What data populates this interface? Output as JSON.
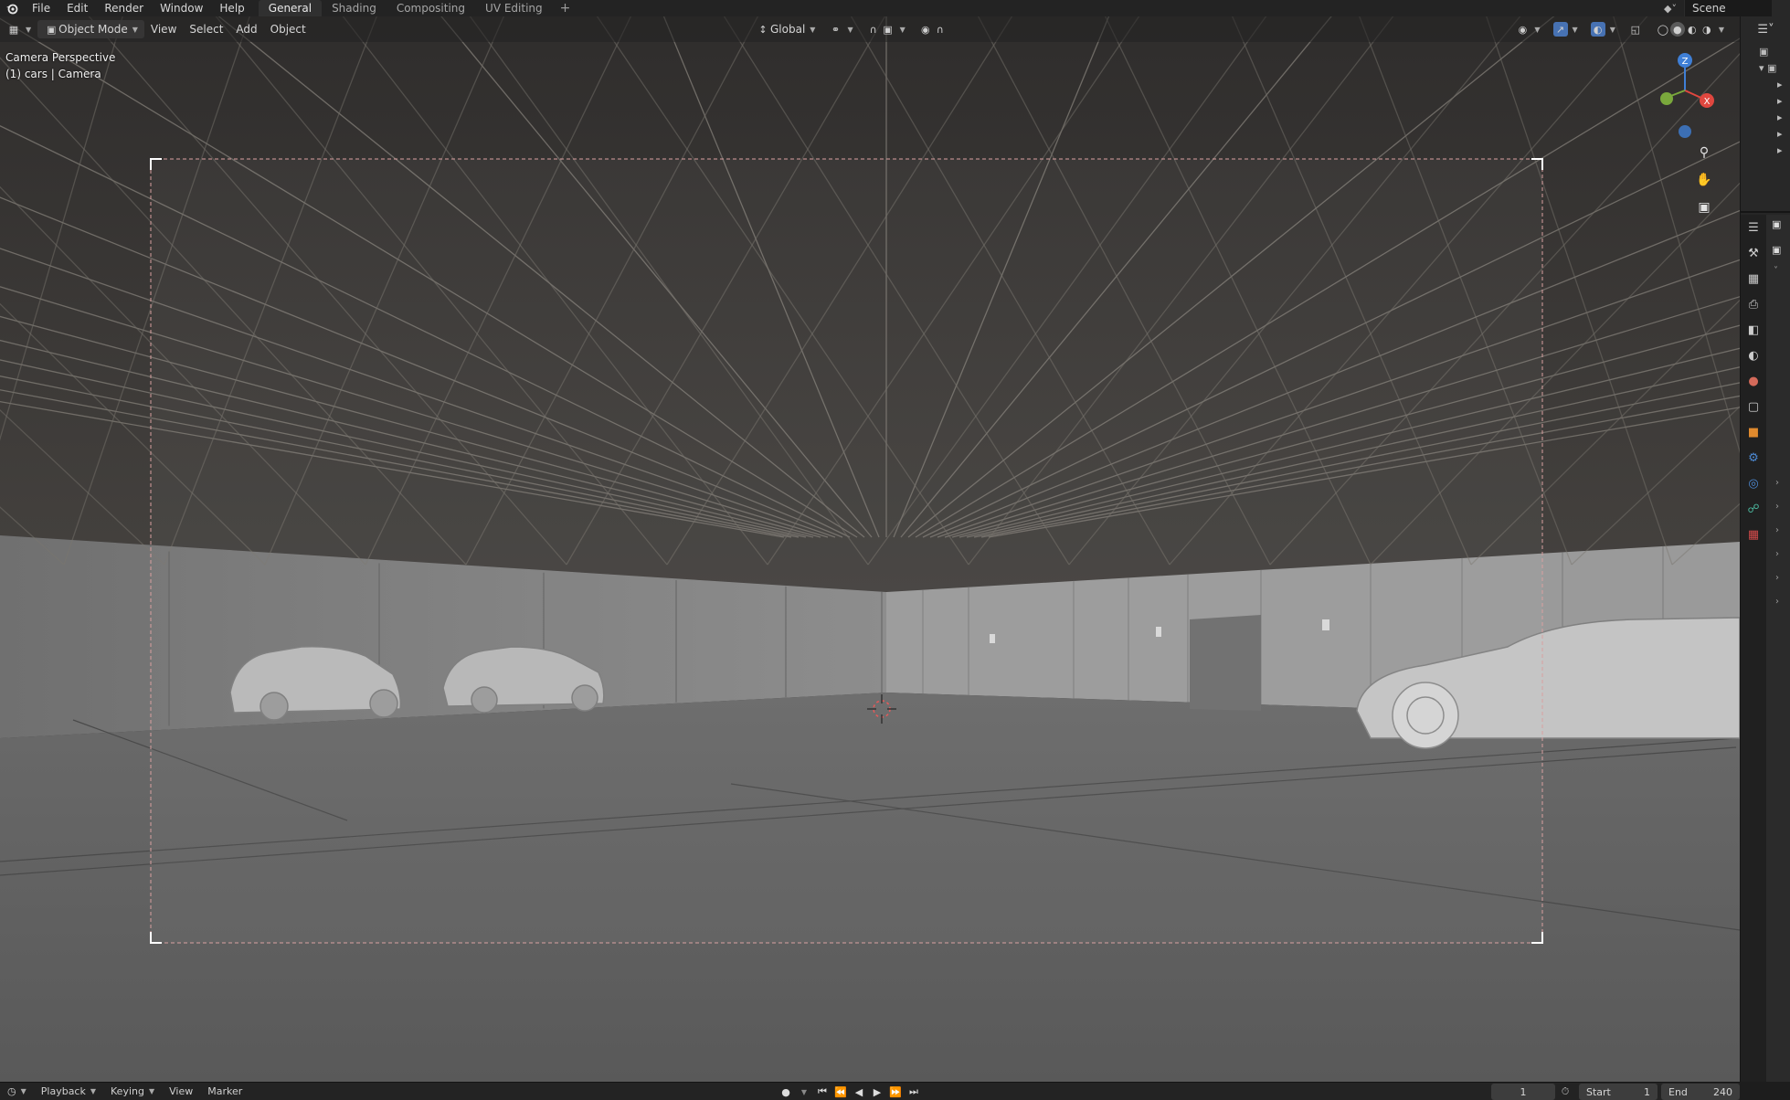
{
  "topbar": {
    "logo_icon": "blender-logo-icon",
    "menus": [
      "File",
      "Edit",
      "Render",
      "Window",
      "Help"
    ],
    "workspace_tabs": [
      "General",
      "Shading",
      "Compositing",
      "UV Editing"
    ],
    "active_tab": "General",
    "add_tab": "+",
    "scene_name": "Scene"
  },
  "viewport_header": {
    "editor_type_icon": "3d-viewport-icon",
    "mode": "Object Mode",
    "menus": [
      "View",
      "Select",
      "Add",
      "Object"
    ],
    "transform_orientation": "Global",
    "pivot_icon": "pivot-icon",
    "snap_icon": "magnet-icon",
    "proportional_icon": "proportional-edit-icon",
    "shading_icons": [
      "wireframe-icon",
      "solid-icon",
      "material-icon",
      "rendered-icon"
    ],
    "active_shading": "solid-icon"
  },
  "viewport": {
    "view_name": "Camera Perspective",
    "object_info": "(1) cars | Camera",
    "gizmo_axes": [
      "Z",
      "X",
      "Y"
    ],
    "nav_icons": [
      "zoom-icon",
      "hand-pan-icon",
      "camera-view-icon"
    ],
    "colors": {
      "axis_x": "#e0473f",
      "axis_y": "#7aa83c",
      "axis_z": "#3f7fd6",
      "camera_frame": "#d9a0a0",
      "ceiling": "#3b3836",
      "floor": "#5e5e5e",
      "wall": "#8a8a8a"
    }
  },
  "properties": {
    "tabs": [
      "tool-icon",
      "render-icon",
      "output-icon",
      "view-layer-icon",
      "scene-icon",
      "world-icon",
      "collection-icon",
      "object-icon",
      "modifiers-icon",
      "physics-icon",
      "constraints-icon",
      "data-icon",
      "texture-icon"
    ]
  },
  "timeline": {
    "editor_icon": "clock-icon",
    "menus": [
      "Playback",
      "Keying",
      "View",
      "Marker"
    ],
    "current_frame": "1",
    "start_label": "Start",
    "start_value": "1",
    "end_label": "End",
    "end_value": "240"
  }
}
